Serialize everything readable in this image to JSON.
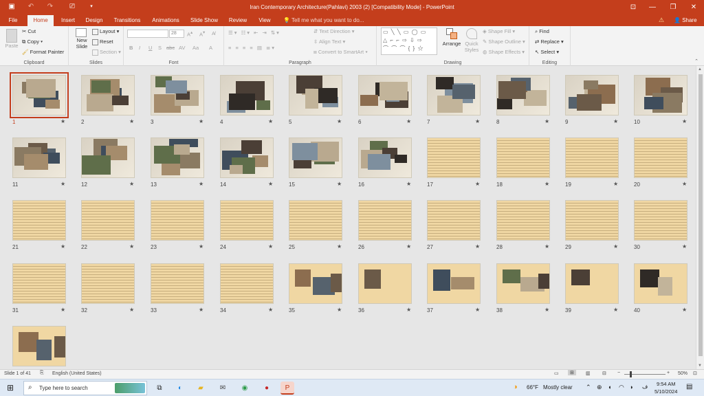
{
  "app": {
    "title": "Iran Contemporary Architecture(Pahlavi)  2003 (2) [Compatibility Mode]  -  PowerPoint",
    "share": "Share"
  },
  "tabs": [
    "File",
    "Home",
    "Insert",
    "Design",
    "Transitions",
    "Animations",
    "Slide Show",
    "Review",
    "View"
  ],
  "tell_me": "Tell me what you want to do...",
  "ribbon": {
    "clipboard": {
      "paste": "Paste",
      "cut": "Cut",
      "copy": "Copy",
      "format_painter": "Format Painter",
      "label": "Clipboard"
    },
    "slides": {
      "new_slide": "New Slide",
      "layout": "Layout",
      "reset": "Reset",
      "section": "Section",
      "label": "Slides"
    },
    "font": {
      "size": "28",
      "label": "Font",
      "buttons": [
        "B",
        "I",
        "U",
        "S",
        "abc",
        "AV",
        "Aa",
        "A"
      ]
    },
    "paragraph": {
      "text_direction": "Text Direction",
      "align_text": "Align Text",
      "convert": "Convert to SmartArt",
      "label": "Paragraph"
    },
    "drawing": {
      "arrange": "Arrange",
      "quick_styles": "Quick Styles",
      "shape_fill": "Shape Fill",
      "shape_outline": "Shape Outline",
      "shape_effects": "Shape Effects",
      "label": "Drawing"
    },
    "editing": {
      "find": "Find",
      "replace": "Replace",
      "select": "Select",
      "label": "Editing"
    }
  },
  "slides": {
    "count": 41,
    "selected": 1,
    "photo_slides": [
      1,
      2,
      3,
      4,
      5,
      6,
      7,
      8,
      9,
      10,
      11,
      12,
      13,
      14,
      15,
      16
    ],
    "sparse_slides": [
      35,
      36,
      37,
      38,
      39,
      40,
      41
    ]
  },
  "status": {
    "slide_of": "Slide 1 of 41",
    "language": "English (United States)",
    "zoom": "50%"
  },
  "taskbar": {
    "search_placeholder": "Type here to search",
    "weather_temp": "66°F",
    "weather_text": "Mostly clear",
    "time": "9:54 AM",
    "date": "5/10/2024"
  },
  "colors": {
    "accent": "#c43e1c",
    "parchment": "#f0d7a3"
  }
}
